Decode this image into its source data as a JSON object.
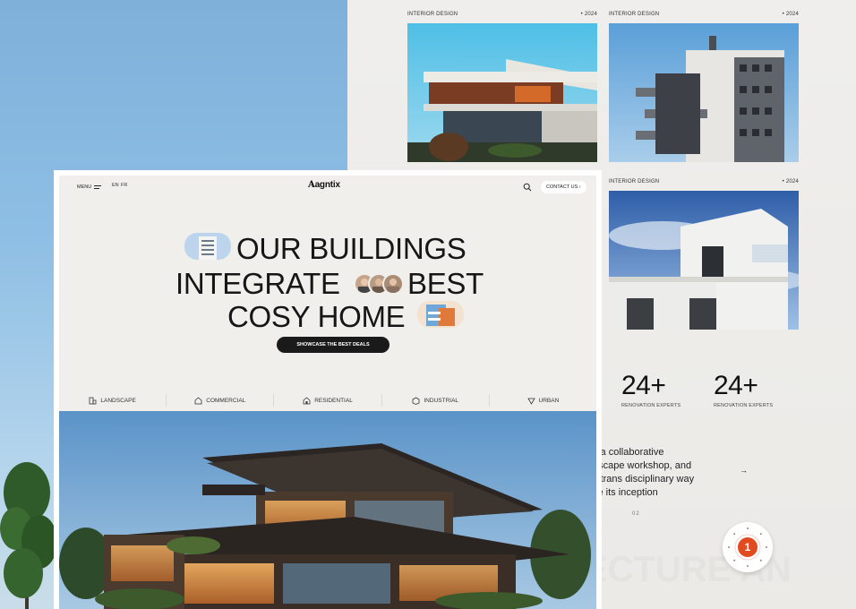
{
  "back_panel": {
    "cards": [
      {
        "category": "INTERIOR DESIGN",
        "year": "• 2024"
      },
      {
        "category": "INTERIOR DESIGN",
        "year": "• 2024"
      },
      {
        "category": "INTERIOR DESIGN",
        "year": "• 2024"
      }
    ],
    "stats": [
      {
        "value": "24+",
        "label": "RENOVATION EXPERTS"
      },
      {
        "value": "24+",
        "label": "RENOVATION EXPERTS"
      }
    ],
    "about_lines": [
      "s a collaborative",
      "dscape workshop, and",
      "s trans disciplinary way",
      "ce its inception"
    ],
    "arrow": "→",
    "pager": "02",
    "big_word": "ECTURE AN",
    "badge_number": "1"
  },
  "front": {
    "nav": {
      "menu_label": "MENU",
      "langs": [
        "EN",
        "FR"
      ],
      "logo": "agntix",
      "contact_label": "CONTACT US ›"
    },
    "hero": {
      "line1": "OUR BUILDINGS",
      "line2a": "INTEGRATE",
      "line2b": "BEST",
      "line3": "COSY HOME"
    },
    "cta_label": "SHOWCASE THE BEST DEALS",
    "categories": [
      {
        "label": "LANDSCAPE",
        "icon": "landscape-icon"
      },
      {
        "label": "COMMERCIAL",
        "icon": "commercial-icon"
      },
      {
        "label": "RESIDENTIAL",
        "icon": "residential-icon"
      },
      {
        "label": "INDUSTRIAL",
        "icon": "industrial-icon"
      },
      {
        "label": "URBAN",
        "icon": "urban-icon"
      }
    ]
  },
  "colors": {
    "accent": "#e24a1f",
    "dark": "#1a1a1a",
    "bg": "#f1efec"
  }
}
